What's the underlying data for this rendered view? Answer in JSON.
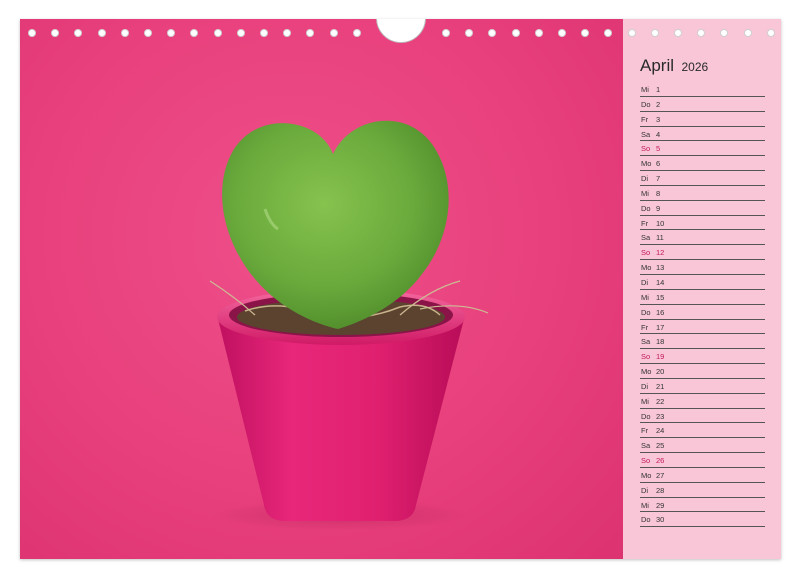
{
  "calendar": {
    "month": "April",
    "year": "2026",
    "days": [
      {
        "wd": "Mi",
        "d": "1"
      },
      {
        "wd": "Do",
        "d": "2"
      },
      {
        "wd": "Fr",
        "d": "3"
      },
      {
        "wd": "Sa",
        "d": "4"
      },
      {
        "wd": "So",
        "d": "5"
      },
      {
        "wd": "Mo",
        "d": "6"
      },
      {
        "wd": "Di",
        "d": "7"
      },
      {
        "wd": "Mi",
        "d": "8"
      },
      {
        "wd": "Do",
        "d": "9"
      },
      {
        "wd": "Fr",
        "d": "10"
      },
      {
        "wd": "Sa",
        "d": "11"
      },
      {
        "wd": "So",
        "d": "12"
      },
      {
        "wd": "Mo",
        "d": "13"
      },
      {
        "wd": "Di",
        "d": "14"
      },
      {
        "wd": "Mi",
        "d": "15"
      },
      {
        "wd": "Do",
        "d": "16"
      },
      {
        "wd": "Fr",
        "d": "17"
      },
      {
        "wd": "Sa",
        "d": "18"
      },
      {
        "wd": "So",
        "d": "19"
      },
      {
        "wd": "Mo",
        "d": "20"
      },
      {
        "wd": "Di",
        "d": "21"
      },
      {
        "wd": "Mi",
        "d": "22"
      },
      {
        "wd": "Do",
        "d": "23"
      },
      {
        "wd": "Fr",
        "d": "24"
      },
      {
        "wd": "Sa",
        "d": "25"
      },
      {
        "wd": "So",
        "d": "26"
      },
      {
        "wd": "Mo",
        "d": "27"
      },
      {
        "wd": "Di",
        "d": "28"
      },
      {
        "wd": "Mi",
        "d": "29"
      },
      {
        "wd": "Do",
        "d": "30"
      }
    ]
  },
  "colors": {
    "background": "#e8407c",
    "sidebar": "#f8c6d6",
    "pot": "#e0206f",
    "cactus": "#6aaa3c"
  },
  "photo": {
    "subject": "heart-shaped-cactus-in-pink-pot-icon"
  }
}
